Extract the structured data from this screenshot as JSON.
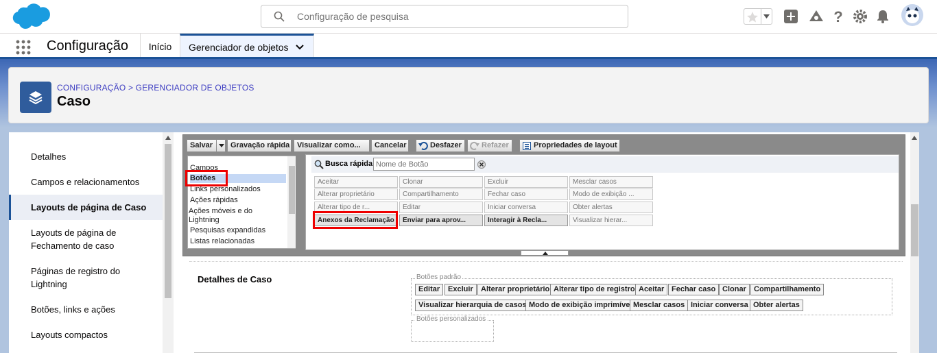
{
  "search": {
    "placeholder": "Configuração de pesquisa"
  },
  "nav": {
    "app_name": "Configuração",
    "tab_home": "Início",
    "tab_object_manager": "Gerenciador de objetos"
  },
  "header": {
    "breadcrumb": "CONFIGURAÇÃO > GERENCIADOR DE OBJETOS",
    "title": "Caso"
  },
  "sidebar": {
    "items": [
      {
        "label": "Detalhes"
      },
      {
        "label": "Campos e relacionamentos"
      },
      {
        "label": "Layouts de página de Caso"
      },
      {
        "label": "Layouts de página de Fechamento de caso"
      },
      {
        "label": "Páginas de registro do Lightning"
      },
      {
        "label": "Botões, links e ações"
      },
      {
        "label": "Layouts compactos"
      }
    ]
  },
  "toolbar": {
    "save": "Salvar",
    "quick_save": "Gravação rápida",
    "preview_as": "Visualizar como...",
    "cancel": "Cancelar",
    "undo": "Desfazer",
    "redo": "Refazer",
    "layout_properties": "Propriedades de layout"
  },
  "categories": [
    "Campos",
    "Botões",
    "Links personalizados",
    "Ações rápidas",
    "Ações móveis e do Lightning",
    "Pesquisas expandidas",
    "Listas relacionadas"
  ],
  "quick_find": {
    "label": "Busca rápida",
    "placeholder": "Nome de Botão"
  },
  "palette_buttons": [
    [
      "Aceitar",
      "Clonar",
      "Excluir",
      "Mesclar casos"
    ],
    [
      "Alterar proprietário",
      "Compartilhamento",
      "Fechar caso",
      "Modo de exibição ..."
    ],
    [
      "Alterar tipo de r...",
      "Editar",
      "Iniciar conversa",
      "Obter alertas"
    ],
    [
      "Anexos da Reclamação",
      "Enviar para aprov...",
      "Interagir à Recla...",
      "Visualizar hierar..."
    ]
  ],
  "section": {
    "title": "Detalhes de Caso",
    "standard_legend": "Botões padrão",
    "custom_legend": "Botões personalizados",
    "standard_row1": [
      "Editar",
      "Excluir",
      "Alterar proprietário",
      "Alterar tipo de registro",
      "Aceitar",
      "Fechar caso",
      "Clonar",
      "Compartilhamento"
    ],
    "standard_row2": [
      "Visualizar hierarquia de casos",
      "Modo de exibição imprimível",
      "Mesclar casos",
      "Iniciar conversa",
      "Obter alertas"
    ]
  }
}
